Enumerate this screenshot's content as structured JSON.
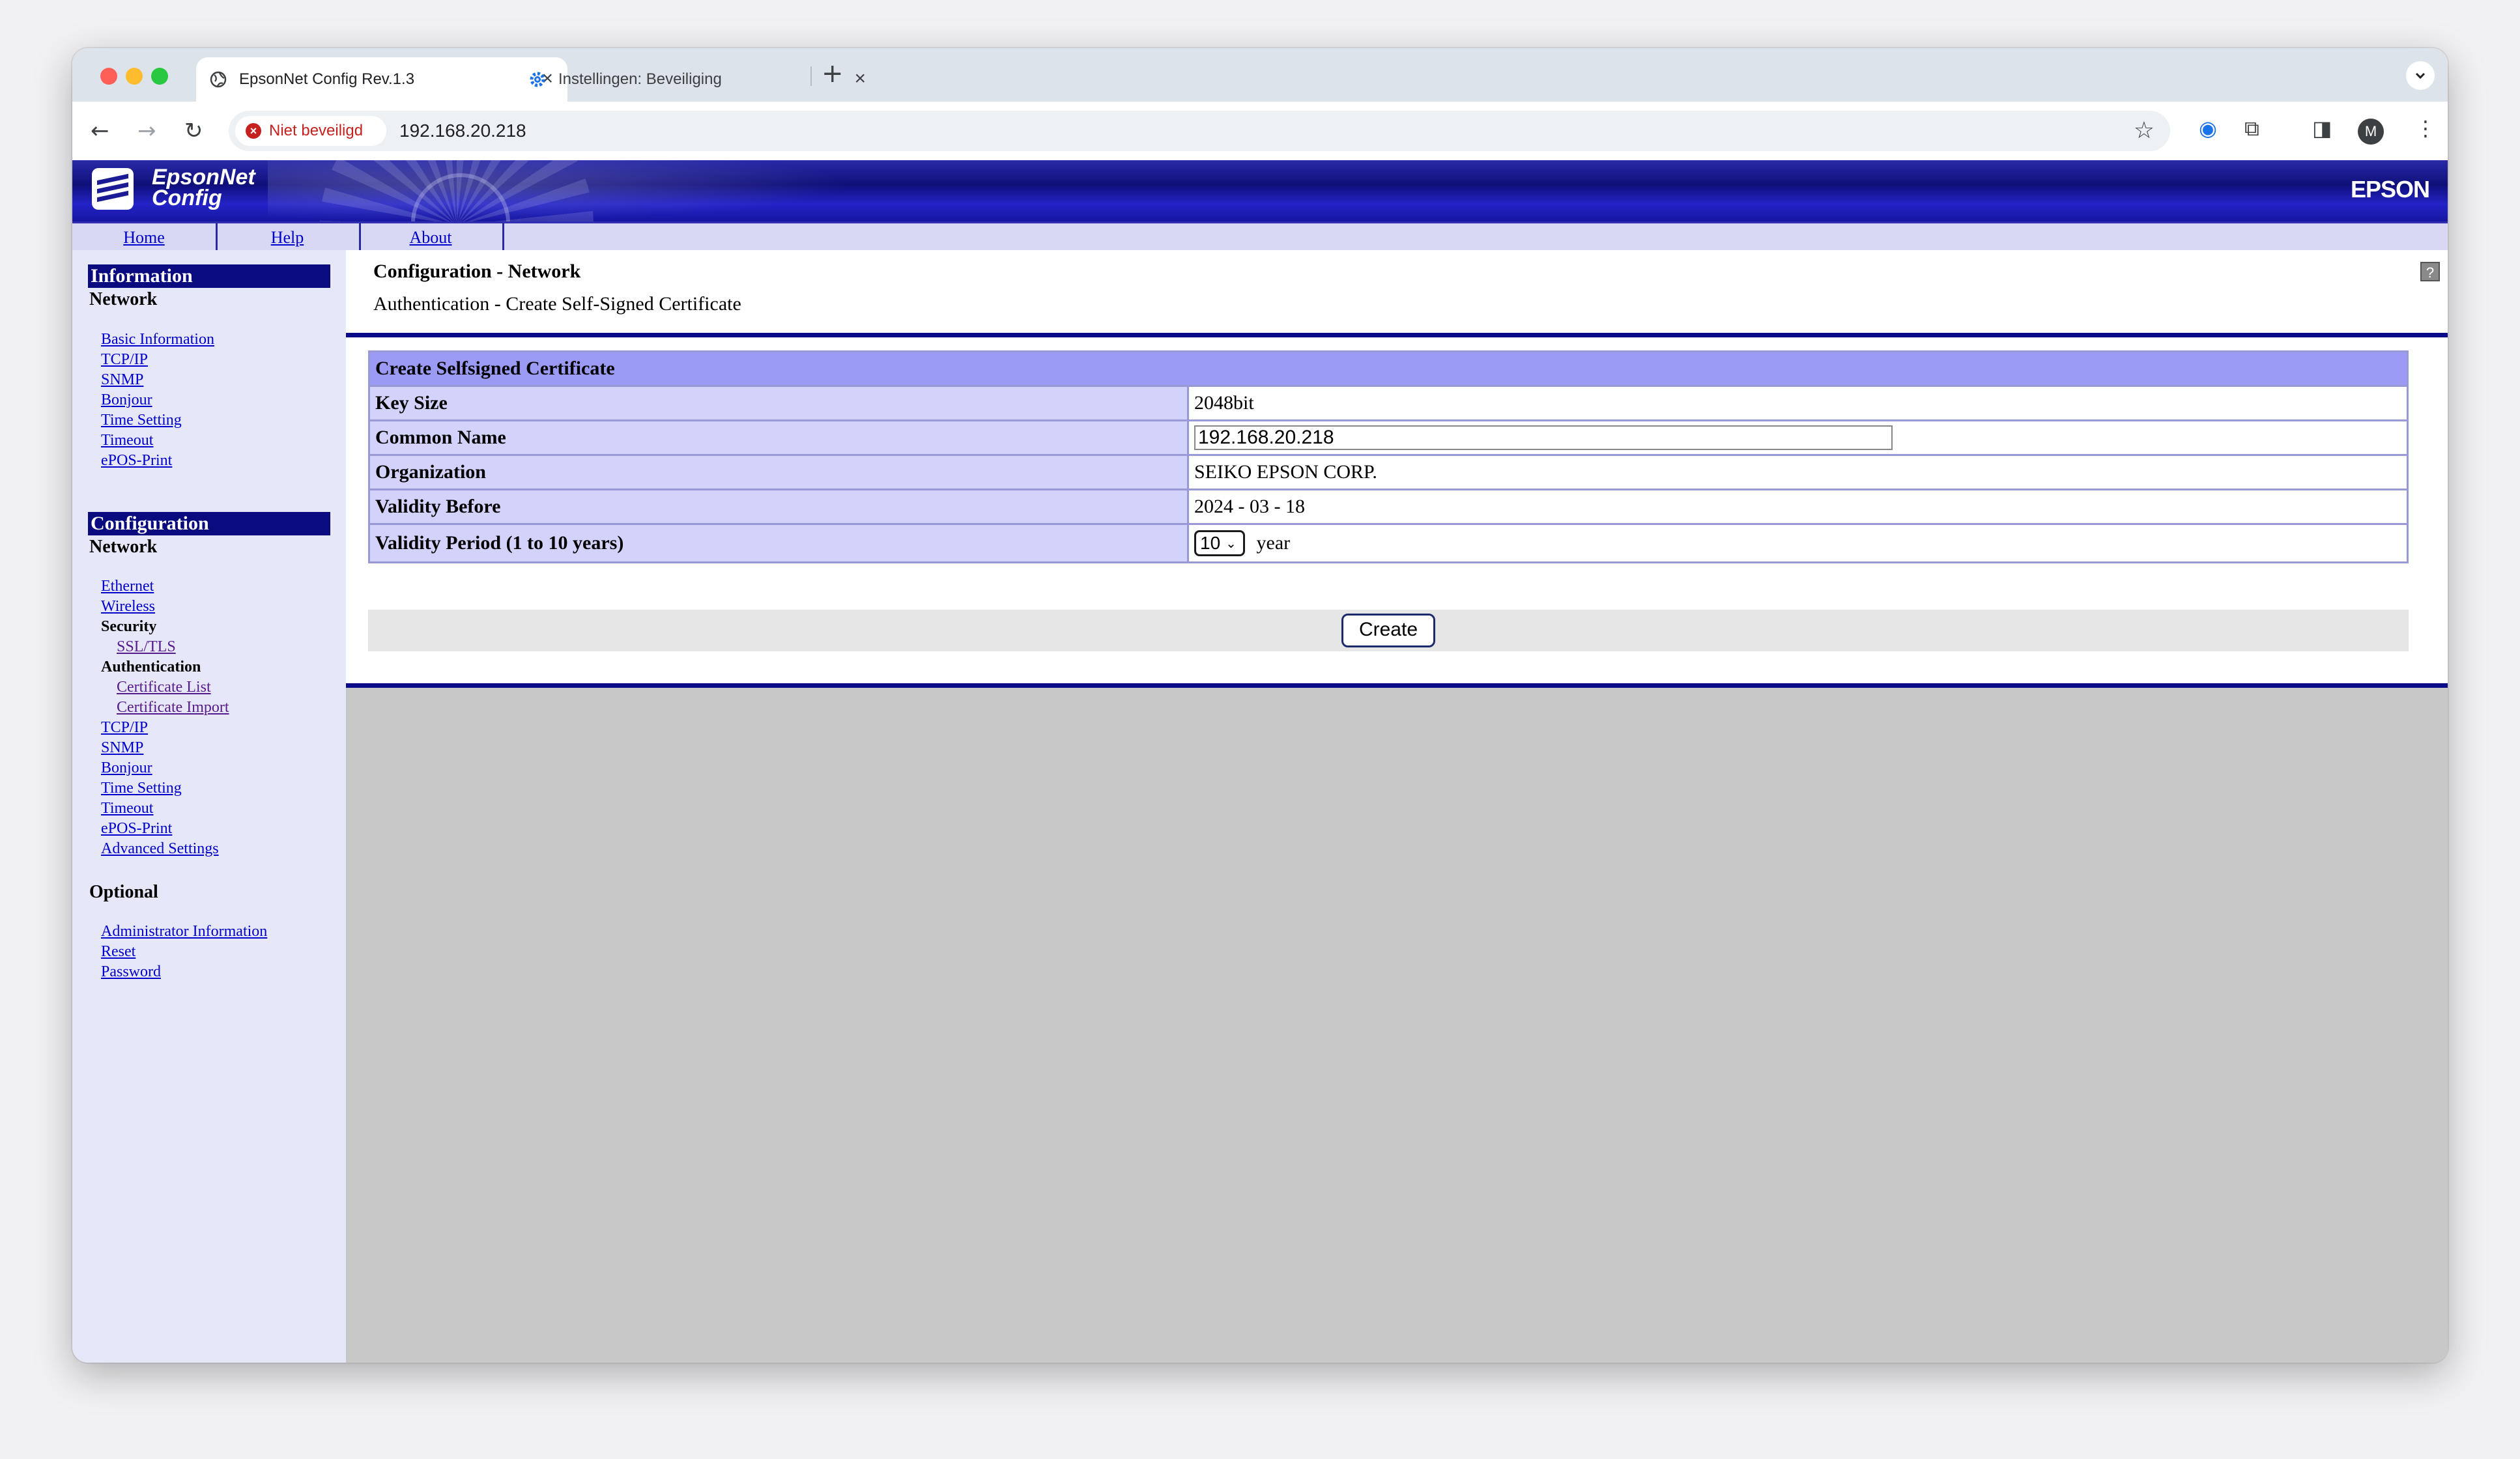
{
  "browser": {
    "tabs": [
      {
        "title": "EpsonNet Config Rev.1.3",
        "icon": "globe-icon",
        "active": true
      },
      {
        "title": "Instellingen: Beveiliging",
        "icon": "gear-icon",
        "active": false
      }
    ],
    "security_chip": "Niet beveiligd",
    "url": "192.168.20.218",
    "profile_initial": "M"
  },
  "banner": {
    "logo_line1": "EpsonNet",
    "logo_line2": "Config",
    "brand": "EPSON"
  },
  "menubar": {
    "home": "Home",
    "help": "Help",
    "about": "About"
  },
  "sidebar": {
    "information": {
      "title": "Information",
      "network_label": "Network",
      "links": [
        "Basic Information",
        "TCP/IP",
        "SNMP",
        "Bonjour",
        "Time Setting",
        "Timeout",
        "ePOS-Print"
      ]
    },
    "configuration": {
      "title": "Configuration",
      "network_label": "Network",
      "ethernet": "Ethernet",
      "wireless": "Wireless",
      "security": "Security",
      "ssl_tls": "SSL/TLS",
      "authentication": "Authentication",
      "certificate_list": "Certificate List",
      "certificate_import": "Certificate Import",
      "links_after": [
        "TCP/IP",
        "SNMP",
        "Bonjour",
        "Time Setting",
        "Timeout",
        "ePOS-Print",
        "Advanced Settings"
      ]
    },
    "optional": {
      "title": "Optional",
      "links": [
        "Administrator Information",
        "Reset",
        "Password"
      ]
    }
  },
  "content": {
    "title": "Configuration - Network",
    "subtitle": "Authentication - Create Self-Signed Certificate",
    "help_icon": "?",
    "table": {
      "header": "Create Selfsigned Certificate",
      "key_size_label": "Key Size",
      "key_size_value": "2048bit",
      "common_name_label": "Common Name",
      "common_name_value": "192.168.20.218",
      "organization_label": "Organization",
      "organization_value": "SEIKO EPSON CORP.",
      "validity_before_label": "Validity Before",
      "validity_before_value": "2024 - 03 - 18",
      "validity_period_label": "Validity Period (1 to 10 years)",
      "validity_period_value": "10",
      "validity_period_unit": "year"
    },
    "create_button": "Create"
  }
}
